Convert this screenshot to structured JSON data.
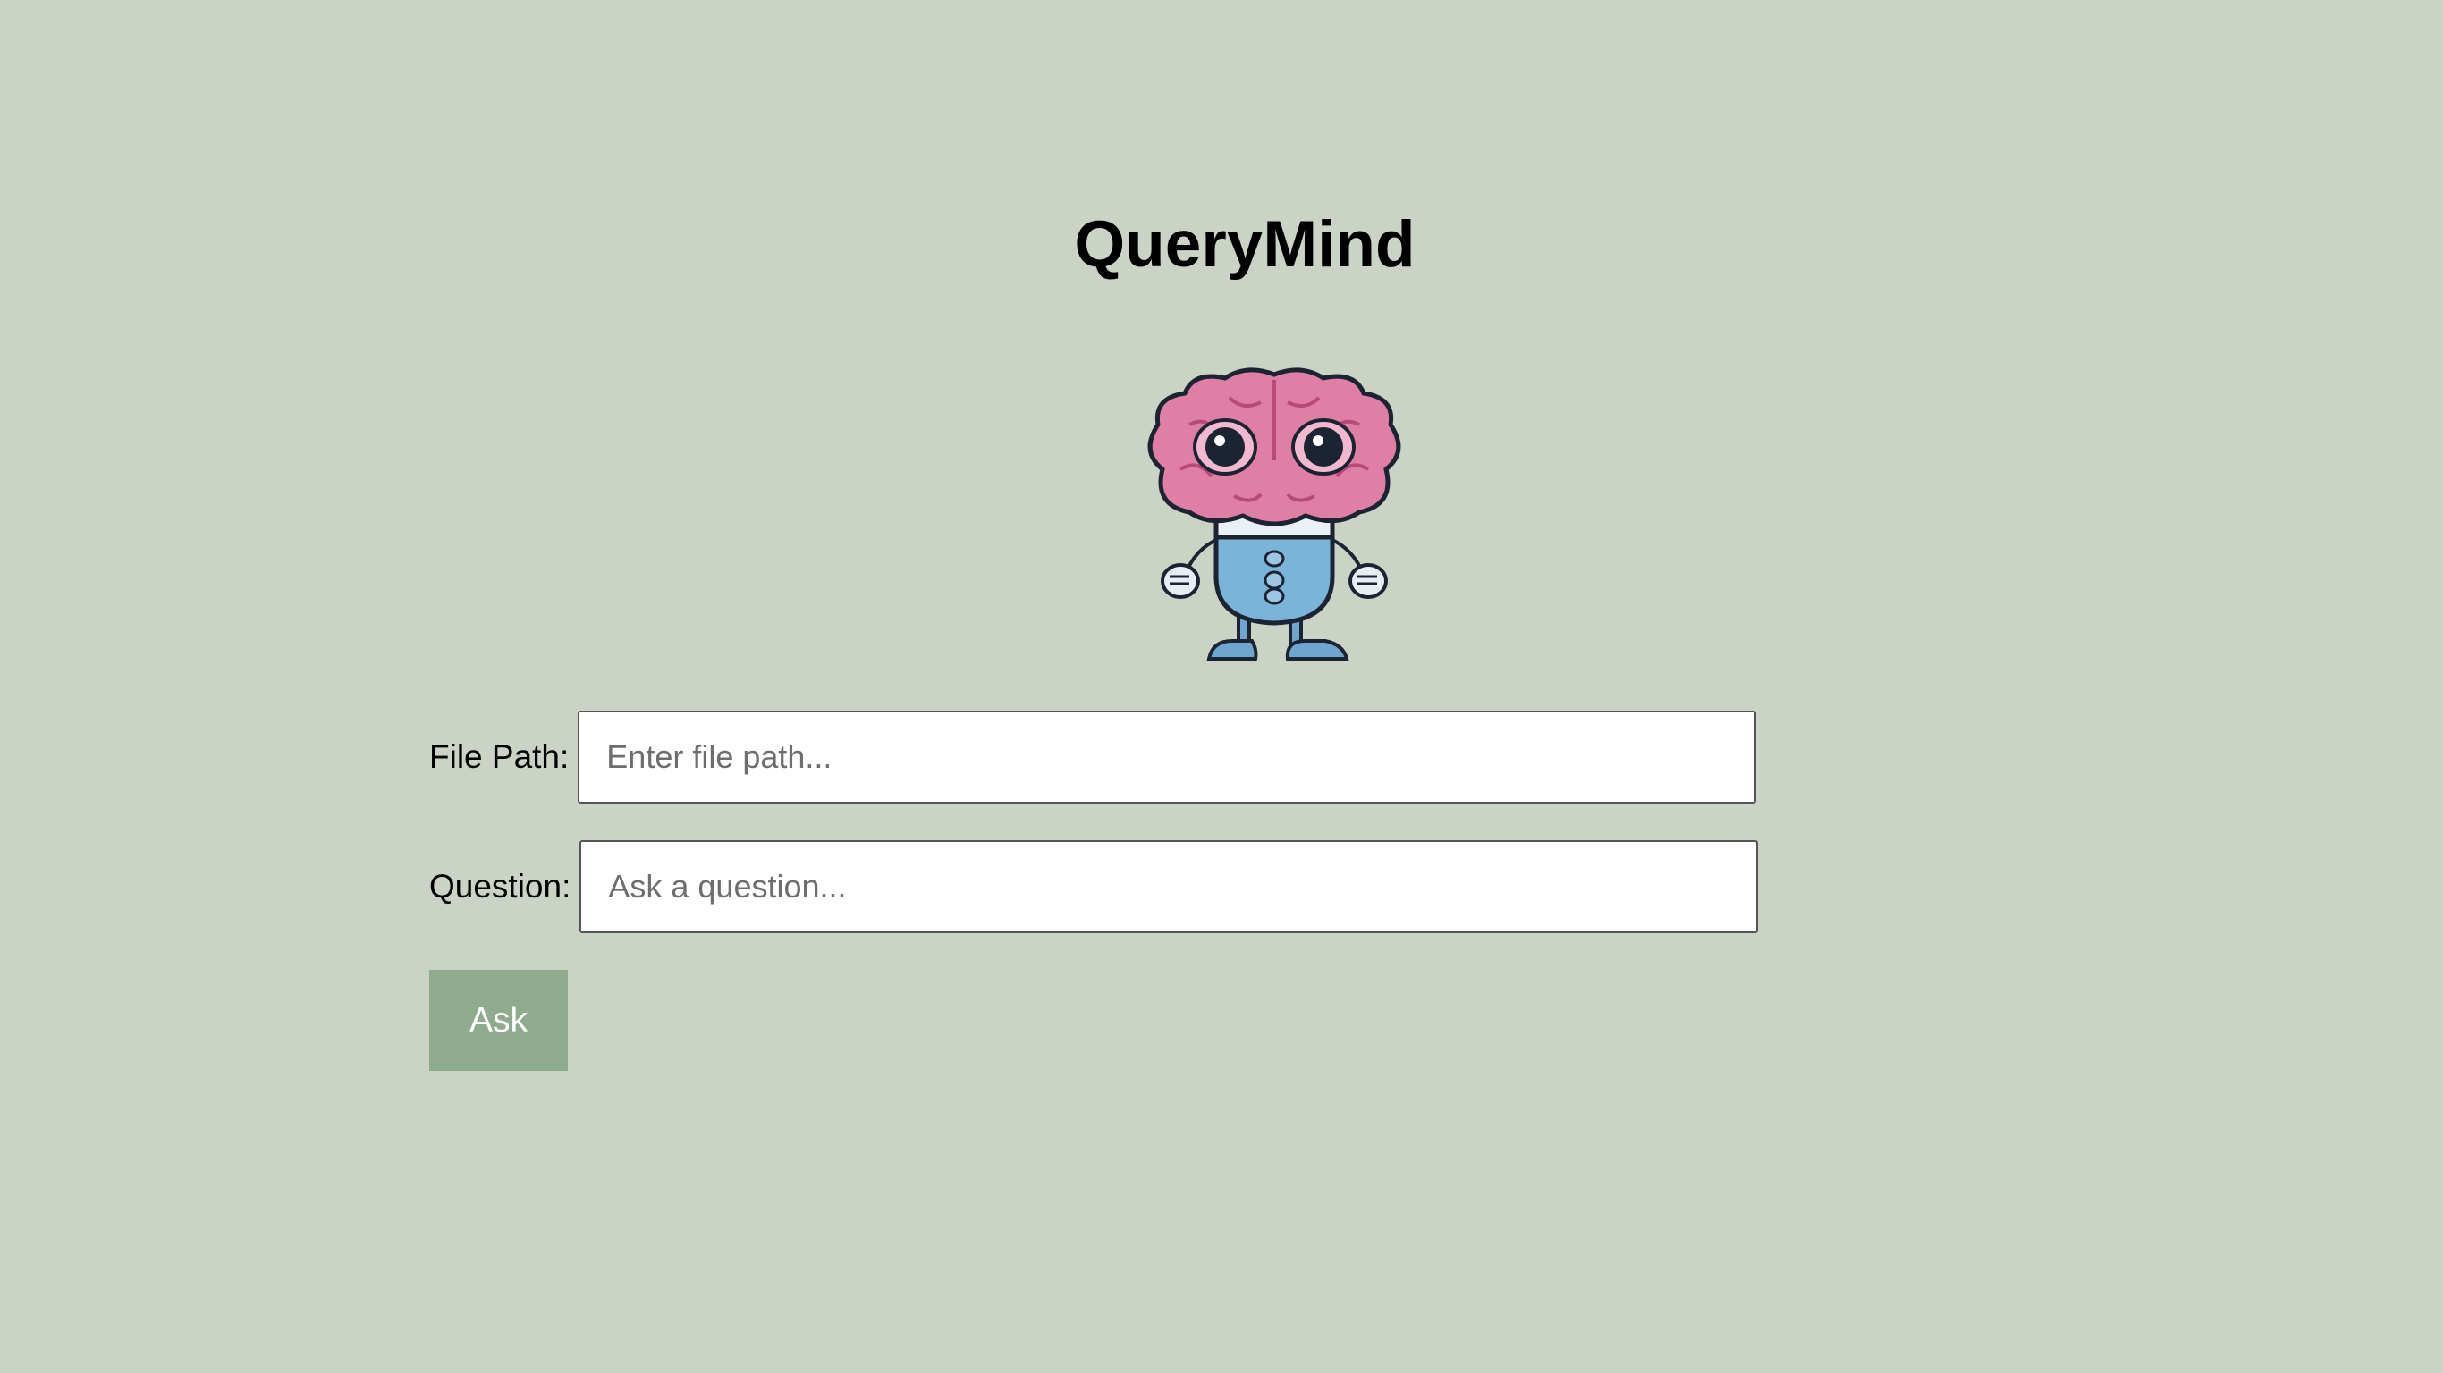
{
  "app": {
    "title": "QueryMind",
    "mascot_icon": "brain-robot-mascot-icon",
    "background_color": "#cbd3c7"
  },
  "form": {
    "file_path": {
      "label": "File Path:",
      "value": "",
      "placeholder": "Enter file path..."
    },
    "question": {
      "label": "Question:",
      "value": "",
      "placeholder": "Ask a question..."
    },
    "ask_button": {
      "label": "Ask",
      "color": "#8fab8e"
    }
  }
}
